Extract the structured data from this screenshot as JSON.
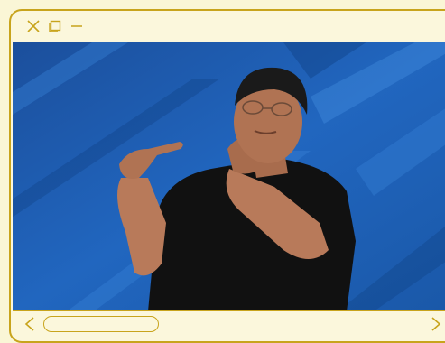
{
  "window": {
    "accent_color": "#c8a41c",
    "background_color": "#fbf7dc",
    "controls": [
      {
        "name": "close",
        "icon": "close-icon"
      },
      {
        "name": "maximize",
        "icon": "maximize-icon"
      },
      {
        "name": "minimize",
        "icon": "minimize-icon"
      }
    ]
  },
  "content": {
    "type": "video-frame",
    "subject": "sign-language-interpreter",
    "background_color": "#1f5fb0"
  },
  "navigation": {
    "prev_icon": "chevron-left-icon",
    "next_icon": "chevron-right-icon",
    "scrollbar_position": 0.0
  }
}
